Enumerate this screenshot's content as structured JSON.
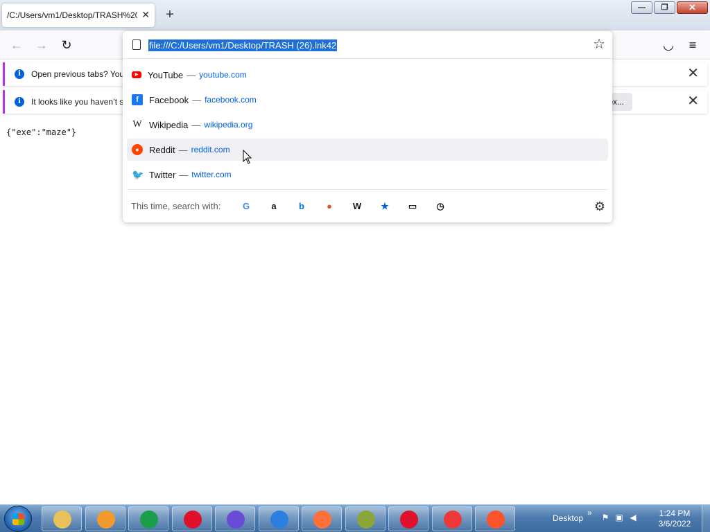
{
  "tab": {
    "title": "/C:/Users/vm1/Desktop/TRASH%20",
    "close_glyph": "✕"
  },
  "new_tab_glyph": "+",
  "window_controls": {
    "minimize": "—",
    "maximize": "❐",
    "close": "✕"
  },
  "nav": {
    "back": "←",
    "forward": "→",
    "reload": "↻",
    "pocket": "◡",
    "menu": "≡"
  },
  "notifications": [
    {
      "text": "Open previous tabs? You",
      "close": "✕"
    },
    {
      "text": "It looks like you haven’t s",
      "button": "...ox...",
      "close": "✕"
    }
  ],
  "page_content": "{\"exe\":\"maze\"}",
  "url_bar": {
    "value": "file:///C:/Users/vm1/Desktop/TRASH (26).lnk42"
  },
  "suggestions": [
    {
      "title": "YouTube",
      "sep": "—",
      "url": "youtube.com",
      "icon": "youtube-icon",
      "glyph": "▶",
      "color": "#ff0000"
    },
    {
      "title": "Facebook",
      "sep": "—",
      "url": "facebook.com",
      "icon": "facebook-icon",
      "glyph": "f",
      "color": "#1877f2"
    },
    {
      "title": "Wikipedia",
      "sep": "—",
      "url": "wikipedia.org",
      "icon": "wikipedia-icon",
      "glyph": "W",
      "color": "#15141a"
    },
    {
      "title": "Reddit",
      "sep": "—",
      "url": "reddit.com",
      "icon": "reddit-icon",
      "glyph": "●",
      "color": "#ff4500"
    },
    {
      "title": "Twitter",
      "sep": "—",
      "url": "twitter.com",
      "icon": "twitter-icon",
      "glyph": "🐦",
      "color": "#1d9bf0"
    }
  ],
  "search_with": {
    "label": "This time, search with:",
    "engines": [
      {
        "name": "google-icon",
        "glyph": "G",
        "color": "#4285f4"
      },
      {
        "name": "amazon-icon",
        "glyph": "a",
        "color": "#111111"
      },
      {
        "name": "bing-icon",
        "glyph": "b",
        "color": "#0078d4"
      },
      {
        "name": "duckduckgo-icon",
        "glyph": "●",
        "color": "#de5833"
      },
      {
        "name": "wikipedia-search-icon",
        "glyph": "W",
        "color": "#15141a"
      },
      {
        "name": "bookmarks-icon",
        "glyph": "★",
        "color": "#0061e0"
      },
      {
        "name": "tabs-icon",
        "glyph": "▭",
        "color": "#15141a"
      },
      {
        "name": "history-icon",
        "glyph": "◷",
        "color": "#15141a"
      }
    ],
    "settings_glyph": "⚙"
  },
  "taskbar": {
    "apps": [
      {
        "name": "file-explorer-icon",
        "color": "#e8c15a"
      },
      {
        "name": "media-player-icon",
        "color": "#f29a2e"
      },
      {
        "name": "chrome-icon",
        "color": "#1a9e4b"
      },
      {
        "name": "opera-icon",
        "color": "#e0112b"
      },
      {
        "name": "firefox-nightly-icon",
        "color": "#6a4bd6"
      },
      {
        "name": "firefox-developer-icon",
        "color": "#2a7fe0"
      },
      {
        "name": "firefox-icon",
        "color": "#ff7139"
      },
      {
        "name": "winrar-icon",
        "color": "#8aa53a"
      },
      {
        "name": "opera-gx-icon",
        "color": "#e0112b"
      },
      {
        "name": "vivaldi-icon",
        "color": "#ef3939"
      },
      {
        "name": "brave-icon",
        "color": "#fb542b"
      }
    ],
    "desktop_label": "Desktop",
    "chevron": "»",
    "time": "1:24 PM",
    "date": "3/6/2022"
  }
}
